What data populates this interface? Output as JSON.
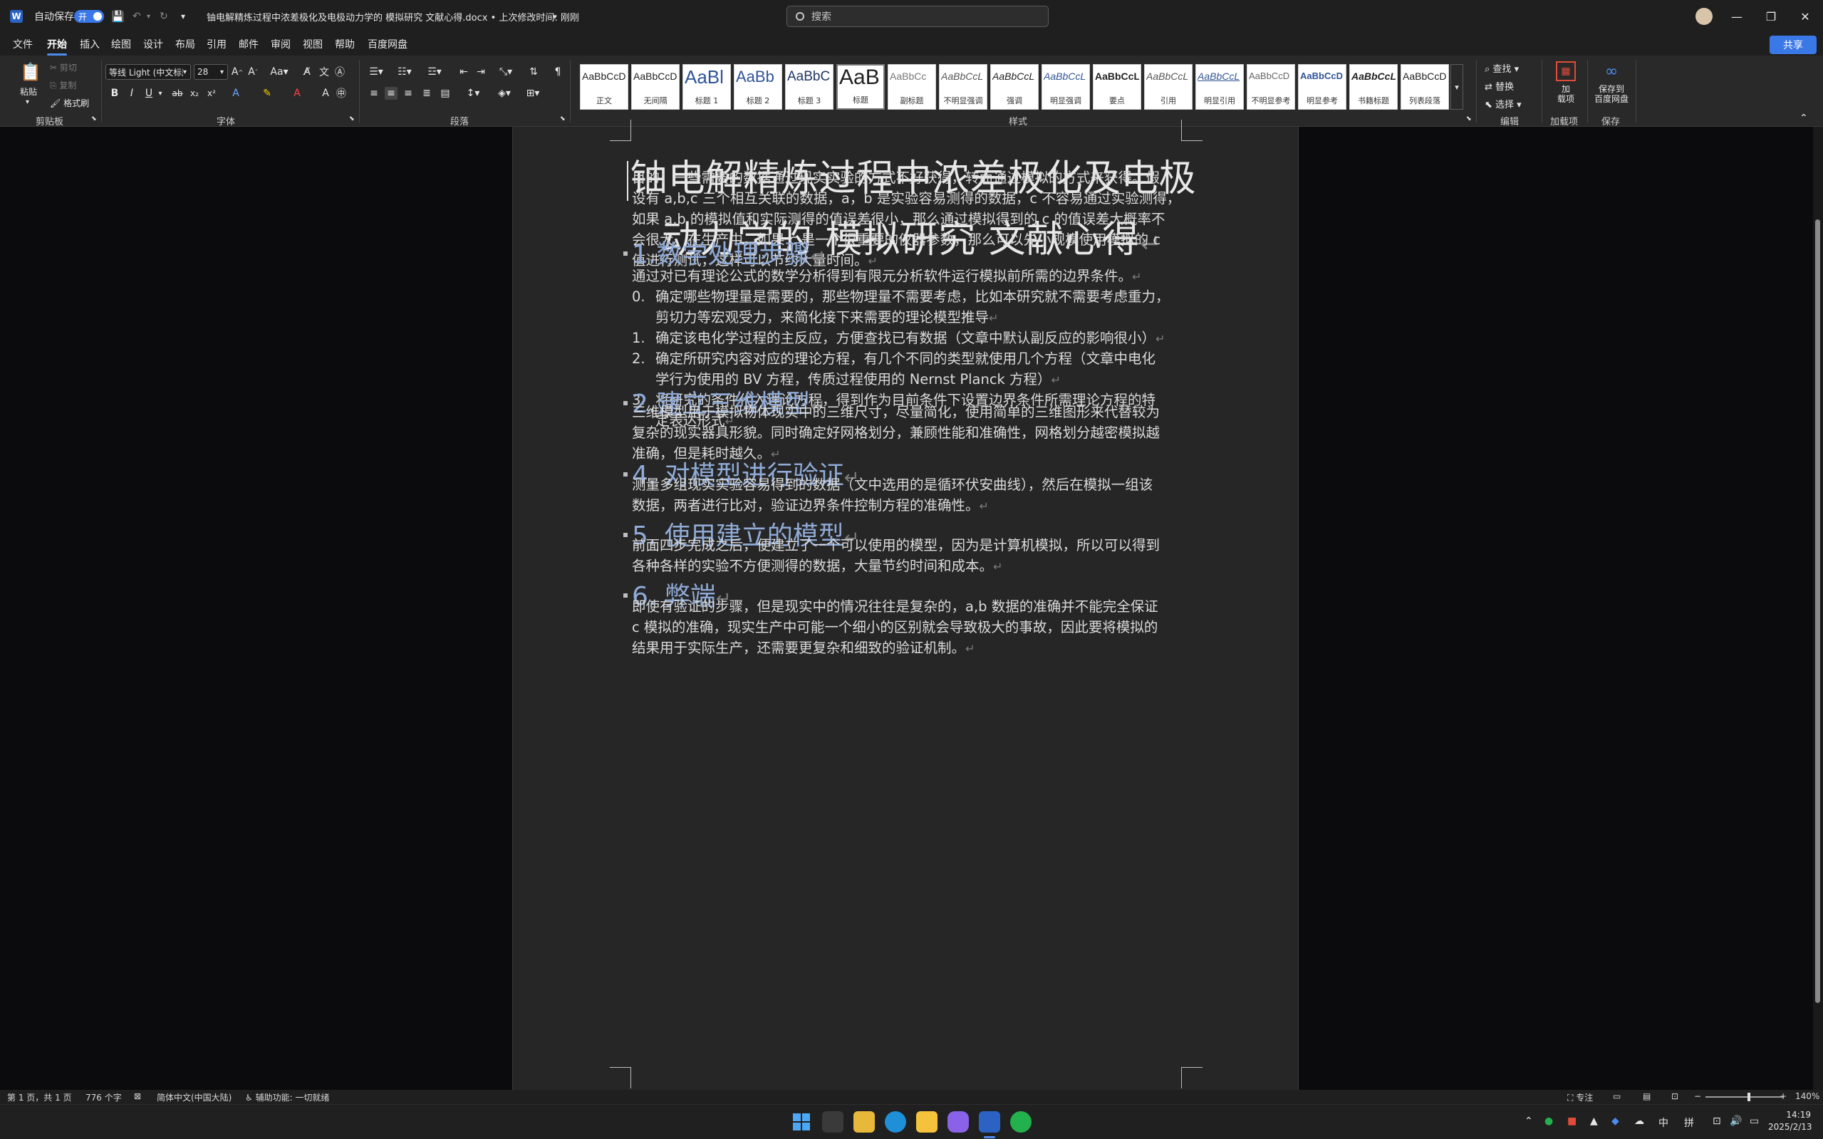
{
  "titlebar": {
    "app_icon": "W",
    "autosave_label": "自动保存",
    "autosave_state": "开",
    "doc_title": "铀电解精炼过程中浓差极化及电极动力学的 模拟研究 文献心得.docx • 上次修改时间: 刚刚",
    "search_placeholder": "搜索",
    "minimize": "—",
    "restore": "❐",
    "close": "✕"
  },
  "menu": {
    "items": [
      "文件",
      "开始",
      "插入",
      "绘图",
      "设计",
      "布局",
      "引用",
      "邮件",
      "审阅",
      "视图",
      "帮助",
      "百度网盘"
    ],
    "active": "开始",
    "share_label": "共享"
  },
  "ribbon": {
    "clipboard": {
      "paste": "粘贴",
      "cut": "剪切",
      "copy": "复制",
      "format_painter": "格式刷",
      "label": "剪贴板"
    },
    "font": {
      "font_name": "等线 Light (中文标题)",
      "font_size": "28",
      "label": "字体"
    },
    "paragraph": {
      "label": "段落"
    },
    "styles": {
      "label": "样式",
      "items": [
        {
          "sample": "AaBbCcD",
          "name": "正文"
        },
        {
          "sample": "AaBbCcD",
          "name": "无间隔"
        },
        {
          "sample": "AaBl",
          "name": "标题 1"
        },
        {
          "sample": "AaBb",
          "name": "标题 2"
        },
        {
          "sample": "AaBbC",
          "name": "标题 3"
        },
        {
          "sample": "AaB",
          "name": "标题"
        },
        {
          "sample": "AaBbCc",
          "name": "副标题"
        },
        {
          "sample": "AaBbCcL",
          "name": "不明显强调"
        },
        {
          "sample": "AaBbCcL",
          "name": "强调"
        },
        {
          "sample": "AaBbCcL",
          "name": "明显强调"
        },
        {
          "sample": "AaBbCcL",
          "name": "要点"
        },
        {
          "sample": "AaBbCcL",
          "name": "引用"
        },
        {
          "sample": "AaBbCcL",
          "name": "明显引用"
        },
        {
          "sample": "AaBbCcD",
          "name": "不明显参考"
        },
        {
          "sample": "AaBbCcD",
          "name": "明显参考"
        },
        {
          "sample": "AaBbCcL",
          "name": "书籍标题"
        },
        {
          "sample": "AaBbCcD",
          "name": "列表段落"
        }
      ]
    },
    "editing": {
      "find": "查找",
      "replace": "替换",
      "select": "选择",
      "label": "编辑"
    },
    "addins": {
      "button": "加\n载项",
      "label": "加载项"
    },
    "save": {
      "button": "保存到\n百度网盘",
      "label": "保存"
    }
  },
  "document": {
    "title_line1": "铀电解精炼过程中浓差极化及电极",
    "title_line2": "动力学的  模拟研究  文献心得",
    "intro": [
      "目的：一些需要的数据通过现实实验的方式不好获得，转而通过模拟的方式来获得。假",
      "设有 a,b,c 三个相互关联的数据，a，b 是实验容易测得的数据，c 不容易通过实验测得，",
      "如果 a,b 的模拟值和实际测得的值误差很小，那么通过模拟得到的 c 的值误差大概率不",
      "会很大。在生产中，如果 c 是一个很重要的仪器参数，那么可以先小规模使用模拟的 c",
      "值进行测试，这样可以节约大量时间。"
    ],
    "sections": [
      {
        "heading": "1.数学处理步骤",
        "body": [
          "通过对已有理论公式的数学分析得到有限元分析软件运行模拟前所需的边界条件。"
        ],
        "list": [
          {
            "num": "0.",
            "lines": [
              "确定哪些物理量是需要的，那些物理量不需要考虑，比如本研究就不需要考虑重力，",
              "剪切力等宏观受力，来简化接下来需要的理论模型推导"
            ]
          },
          {
            "num": "1.",
            "lines": [
              "确定该电化学过程的主反应，方便查找已有数据（文章中默认副反应的影响很小）"
            ]
          },
          {
            "num": "2.",
            "lines": [
              "确定所研究内容对应的理论方程，有几个不同的类型就使用几个方程（文章中电化",
              "学行为使用的 BV 方程，传质过程使用的 Nernst Planck 方程）"
            ]
          },
          {
            "num": "3.",
            "lines": [
              "将研究的条件代入理论方程，得到作为目前条件下设置边界条件所需理论方程的特",
              "定表达形式"
            ]
          }
        ]
      },
      {
        "heading": "2.建立三维模型",
        "body": [
          "三维模型用于模拟物体现实中的三维尺寸，尽量简化，使用简单的三维图形来代替较为",
          "复杂的现实器具形貌。同时确定好网格划分，兼顾性能和准确性，网格划分越密模拟越",
          "准确，但是耗时越久。"
        ]
      },
      {
        "heading": "4. 对模型进行验证",
        "body": [
          "测量多组现实实验容易得到的数据（文中选用的是循环伏安曲线），然后在模拟一组该",
          "数据，两者进行比对，验证边界条件控制方程的准确性。"
        ]
      },
      {
        "heading": "5. 使用建立的模型",
        "body": [
          "前面四步完成之后，便建立了一个可以使用的模型，因为是计算机模拟，所以可以得到",
          "各种各样的实验不方便测得的数据，大量节约时间和成本。"
        ]
      },
      {
        "heading": "6. 弊端",
        "body": [
          "即使有验证的步骤，但是现实中的情况往往是复杂的，a,b 数据的准确并不能完全保证",
          "c 模拟的准确，现实生产中可能一个细小的区别就会导致极大的事故，因此要将模拟的",
          "结果用于实际生产，还需要更复杂和细致的验证机制。"
        ]
      }
    ],
    "para_mark": "↵"
  },
  "statusbar": {
    "page": "第 1 页，共 1 页",
    "words": "776 个字",
    "language": "简体中文(中国大陆)",
    "accessibility": "辅助功能: 一切就绪",
    "focus": "专注",
    "zoom": "140%",
    "zoom_level": 1.4
  },
  "taskbar": {
    "time": "14:19",
    "date": "2025/2/13",
    "ime1": "中",
    "ime2": "拼"
  },
  "colors": {
    "accent": "#3b78e7",
    "heading": "#8faad6",
    "page_bg": "#262626"
  }
}
